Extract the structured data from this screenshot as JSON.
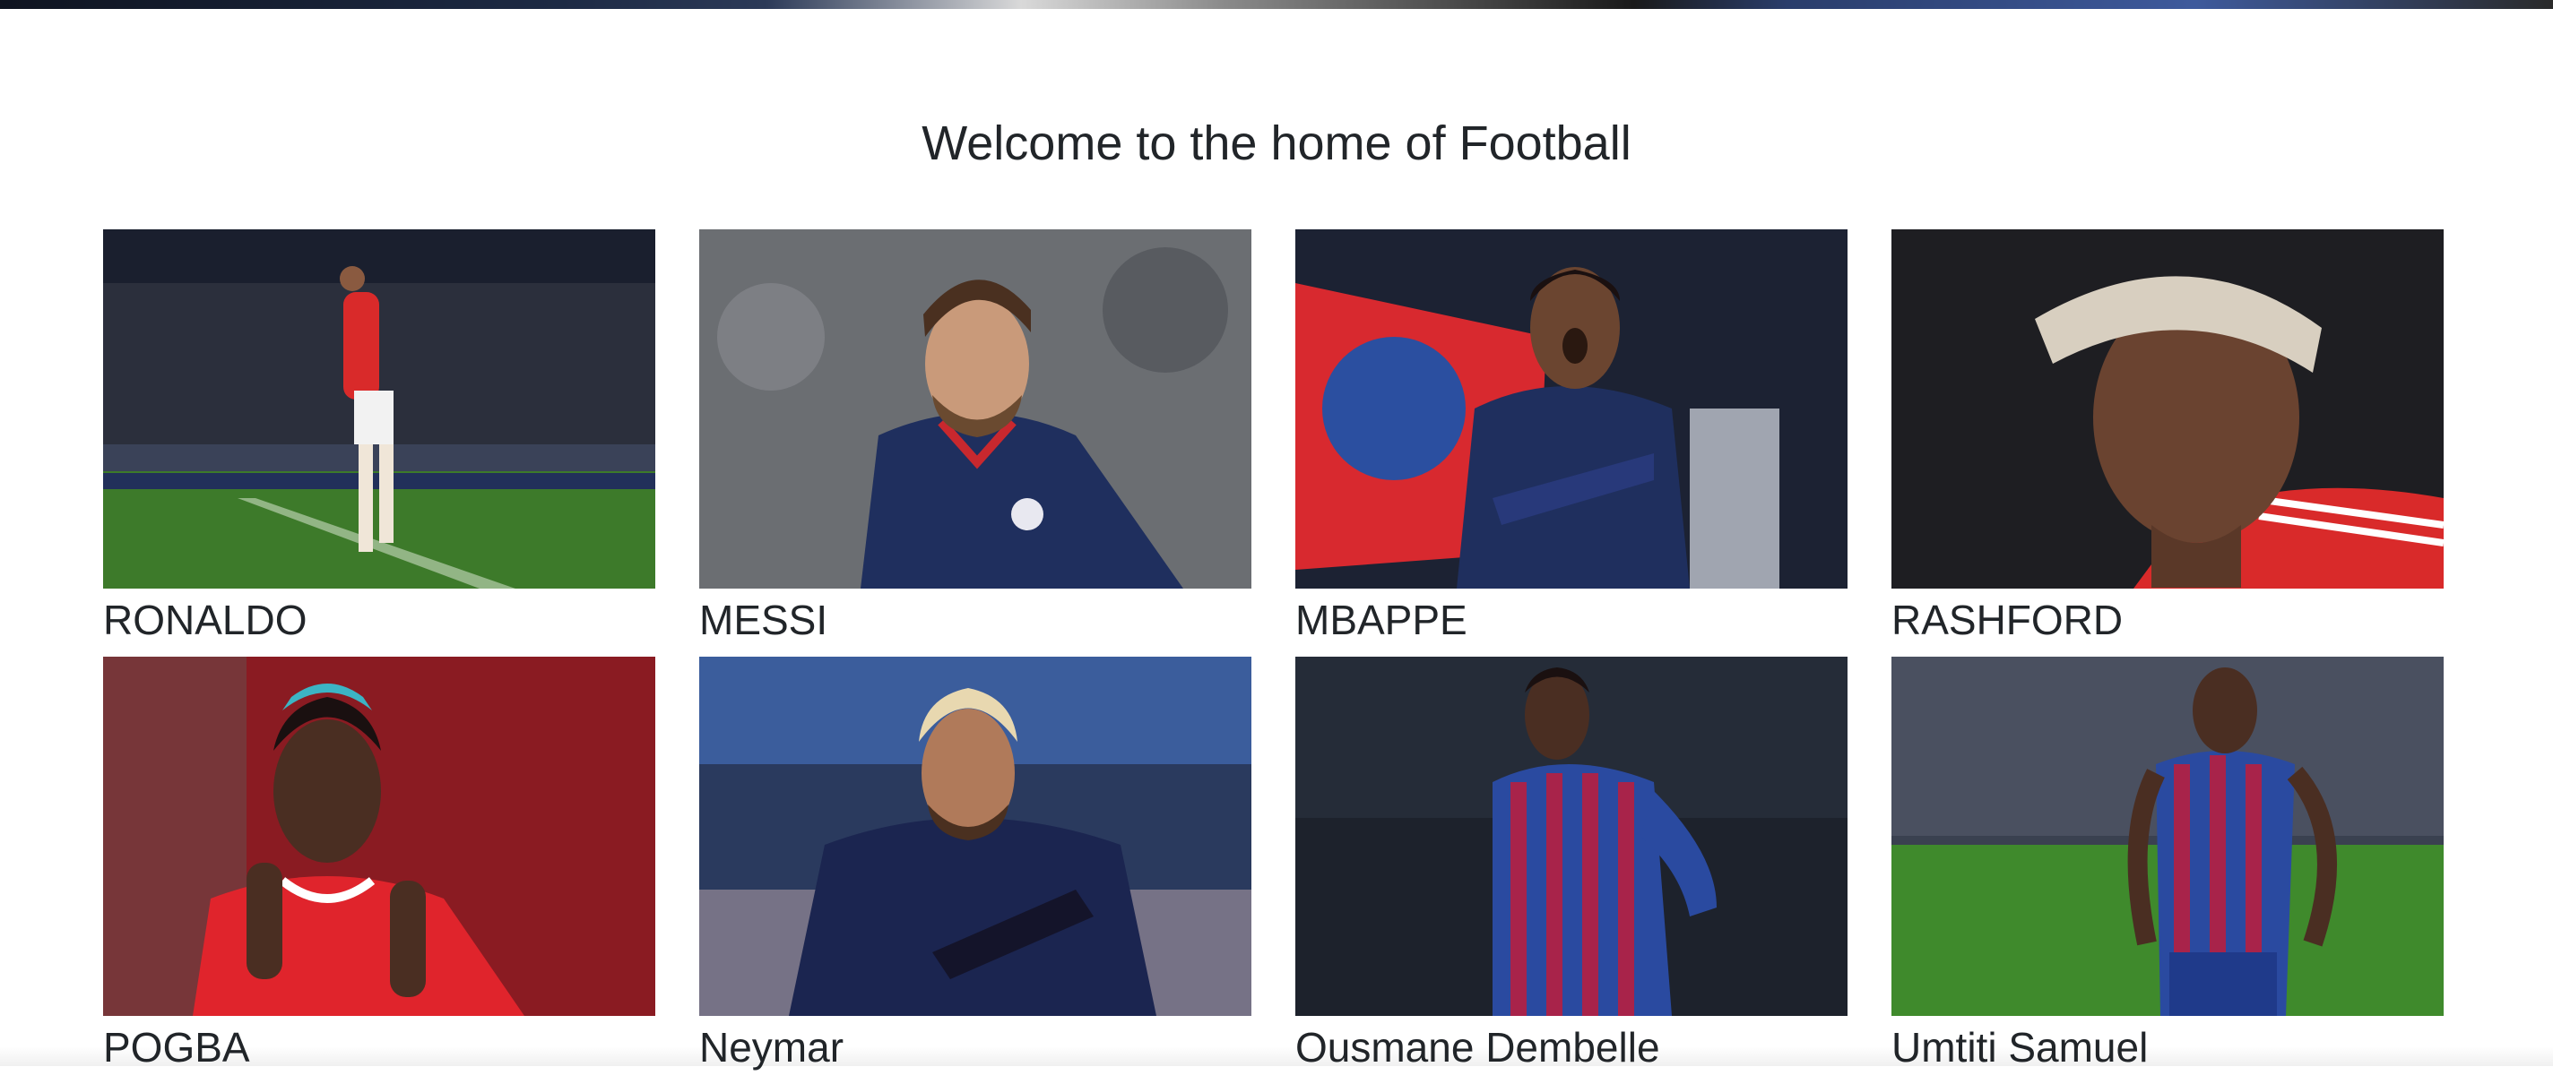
{
  "page": {
    "heading": "Welcome to the home of Football"
  },
  "players": [
    {
      "name": "RONALDO",
      "photo_icon": "player-celebration-photo",
      "colors": {
        "bg": "#1a1f2e",
        "pitch": "#3d7a2a",
        "kit": "#d92a2a",
        "shorts": "#ffffff"
      }
    },
    {
      "name": "MESSI",
      "photo_icon": "player-portrait-photo",
      "colors": {
        "bg": "#6b6e72",
        "kit": "#1f2f5e",
        "skin": "#c99a7a",
        "hair": "#4a3020"
      }
    },
    {
      "name": "MBAPPE",
      "photo_icon": "player-portrait-photo",
      "colors": {
        "bg": "#1c2233",
        "flag": "#d8292f",
        "kit": "#1f2f5e",
        "skin": "#6b4530"
      }
    },
    {
      "name": "RASHFORD",
      "photo_icon": "player-portrait-photo",
      "colors": {
        "bg": "#1e1e22",
        "kit": "#d92a2a",
        "skin": "#6a4330",
        "hair": "#d8cfc0"
      }
    },
    {
      "name": "POGBA",
      "photo_icon": "player-portrait-photo",
      "colors": {
        "bg": "#8a1b22",
        "kit": "#e0242c",
        "skin": "#4a2e22",
        "hair": "#3cb4c4"
      }
    },
    {
      "name": "Neymar",
      "photo_icon": "player-portrait-photo",
      "colors": {
        "bg": "#2a3a5e",
        "kit": "#1b2550",
        "skin": "#b07a5a",
        "hair": "#e8d8b0"
      }
    },
    {
      "name": "Ousmane Dembelle",
      "photo_icon": "player-standing-photo",
      "colors": {
        "bg": "#1d222c",
        "kit_a": "#a8234a",
        "kit_b": "#2a4aa0",
        "skin": "#4a2e22"
      }
    },
    {
      "name": "Umtiti Samuel",
      "photo_icon": "player-standing-photo",
      "colors": {
        "bg": "#3a4150",
        "pitch": "#3f8a2c",
        "kit_a": "#a8234a",
        "kit_b": "#2a4aa0",
        "skin": "#4a2e22"
      }
    }
  ]
}
